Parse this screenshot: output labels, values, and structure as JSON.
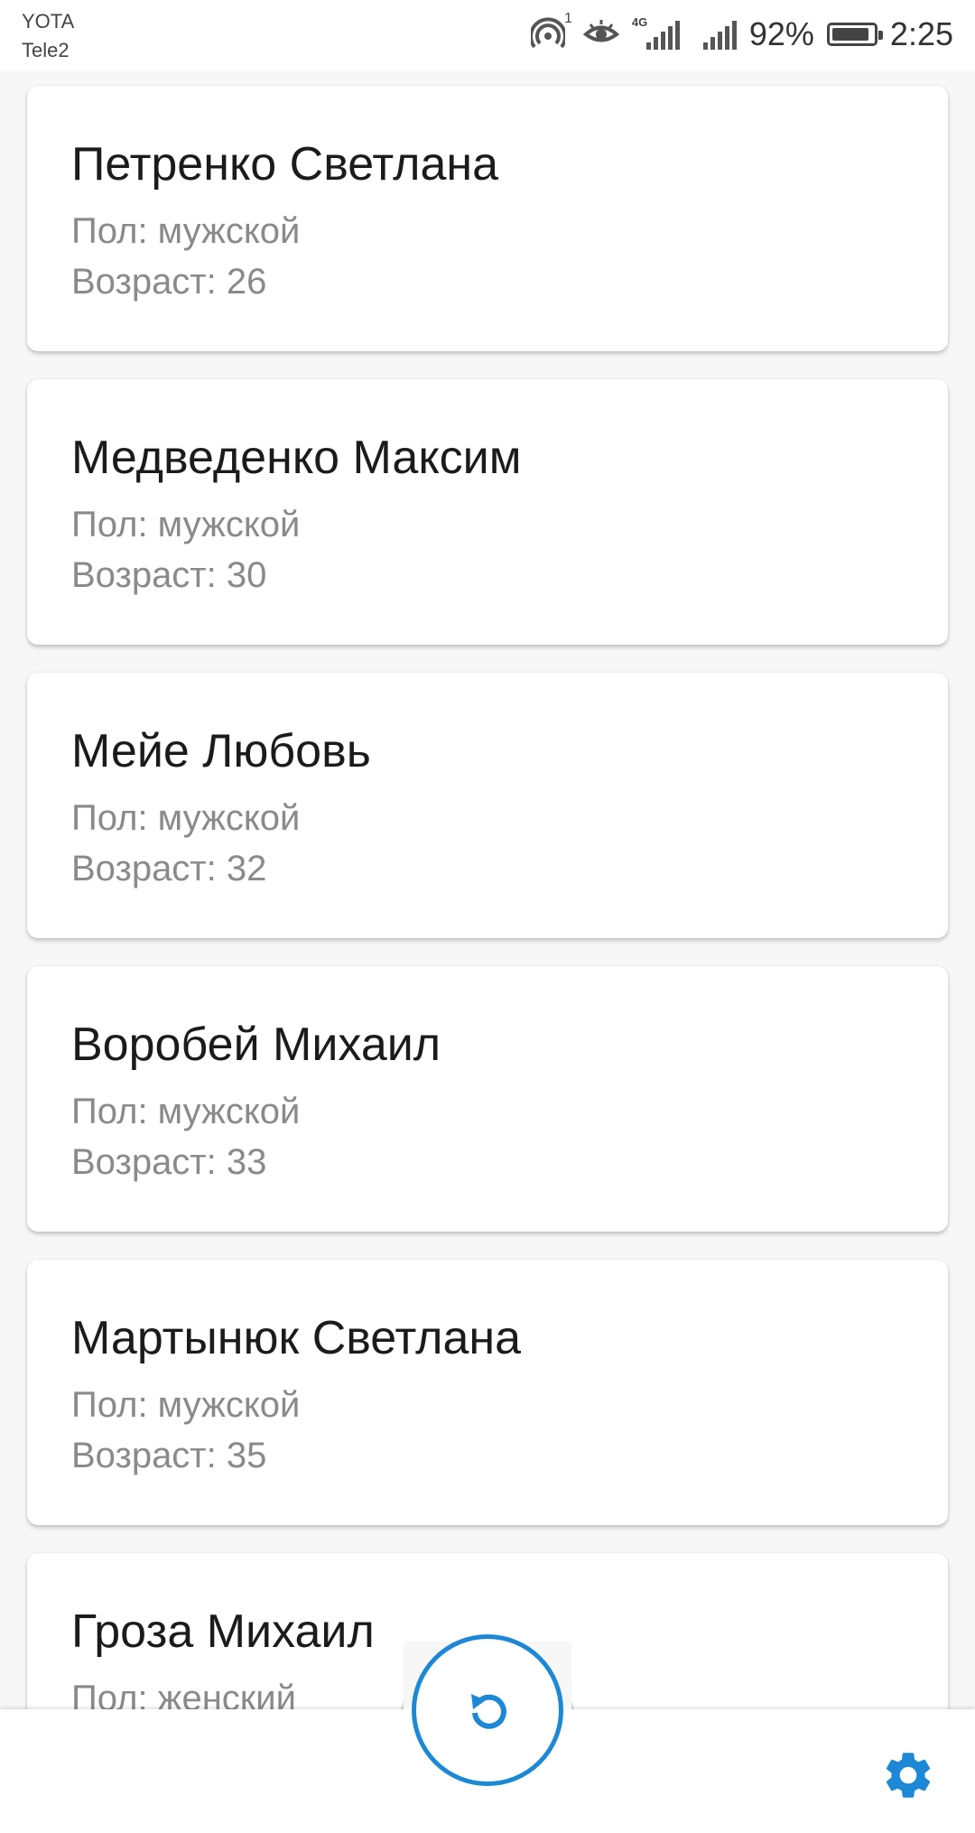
{
  "status_bar": {
    "carrier_1": "YOTA",
    "carrier_2": "Tele2",
    "sim_slot": "1",
    "network_type": "4G",
    "battery_percent": "92%",
    "battery_level": 0.92,
    "time": "2:25"
  },
  "people": [
    {
      "name": "Петренко Светлана",
      "gender": "Пол: мужской",
      "age": "Возраст: 26"
    },
    {
      "name": "Медведенко Максим",
      "gender": "Пол: мужской",
      "age": "Возраст: 30"
    },
    {
      "name": "Мейе Любовь",
      "gender": "Пол: мужской",
      "age": "Возраст: 32"
    },
    {
      "name": "Воробей Михаил",
      "gender": "Пол: мужской",
      "age": "Возраст: 33"
    },
    {
      "name": "Мартынюк Светлана",
      "gender": "Пол: мужской",
      "age": "Возраст: 35"
    },
    {
      "name": "Гроза Михаил",
      "gender": "Пол: женский",
      "age": ""
    }
  ],
  "icons": {
    "refresh": "refresh-icon",
    "settings": "gear-icon"
  },
  "colors": {
    "accent": "#1c88d6",
    "secondary_text": "#8a8a8a"
  }
}
